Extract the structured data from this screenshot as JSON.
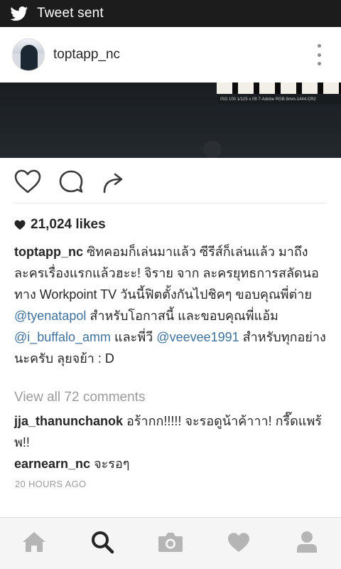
{
  "status_bar": {
    "label": "Tweet sent",
    "icon": "twitter-bird-icon"
  },
  "post": {
    "username": "toptapp_nc",
    "photo_meta": "ISO 100   1/125 s   f/8        7-Adobe RGB 8mm-1444.CR2",
    "likes": "21,024 likes",
    "caption": {
      "username": "toptapp_nc",
      "part1": " ซิทคอมก็เล่นมาแล้ว ซีรีส์ก็เล่นแล้ว มาถึงละครเรื่องแรกแล้วฮะะ! จิราย จาก ละครยุทธการสลัดนอ ทาง Workpoint TV วันนี้ฟิตตั้งกันไปชิคๆ ขอบคุณพี่ต่าย ",
      "mention1": "@tyenatapol",
      "part2": " สำหรับโอกาสนี้ และขอบคุณพี่แอ้ม ",
      "mention2": "@i_buffalo_amm",
      "part3": " และพี่วี ",
      "mention3": "@veevee1991",
      "part4": " สำหรับทุกอย่างนะครับ ลุยจย้า : D"
    },
    "view_all": "View all 72 comments",
    "comments": [
      {
        "username": "jja_thanunchanok",
        "text": " อร้ากก!!!!! จะรอดูน้าค้าาา! กรี๊ดแพร้พ!!"
      },
      {
        "username": "earnearn_nc",
        "text": " จะรอๆ"
      }
    ],
    "timestamp": "20 HOURS AGO"
  },
  "bottom_nav": {
    "items": [
      "home-icon",
      "search-icon",
      "camera-icon",
      "heart-icon",
      "profile-icon"
    ],
    "active": "search-icon"
  },
  "colors": {
    "mention": "#3f729b",
    "muted": "#9b9b9b",
    "status_bar": "#1c1c1c",
    "nav_active": "#262626",
    "nav_inactive": "#b5b5b5"
  }
}
